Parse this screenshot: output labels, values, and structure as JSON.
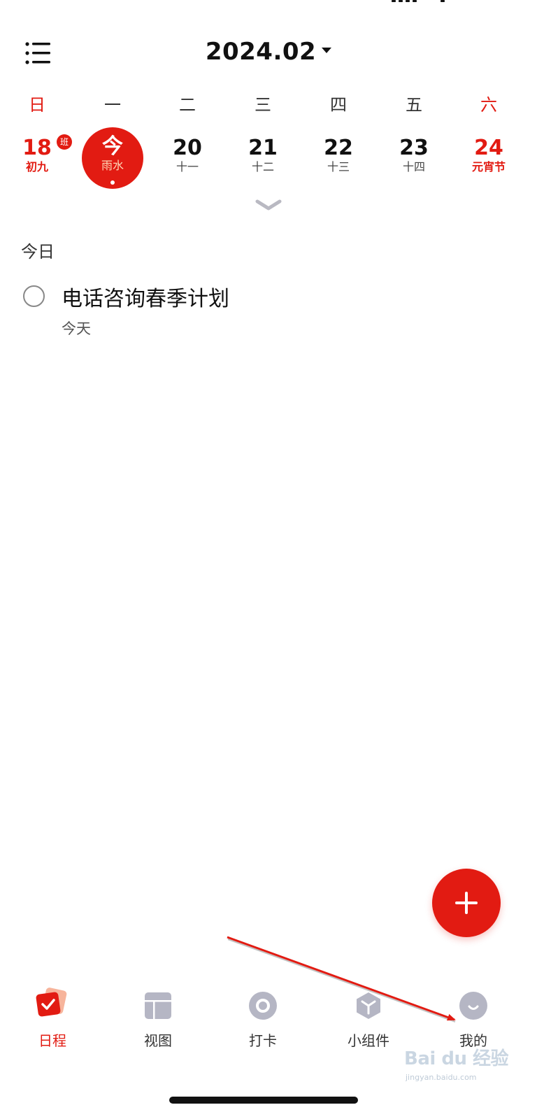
{
  "header": {
    "month_title": "2024.02"
  },
  "weekdays": [
    "日",
    "一",
    "二",
    "三",
    "四",
    "五",
    "六"
  ],
  "dates": [
    {
      "num": "18",
      "lunar": "初九",
      "badge": "班",
      "red": true
    },
    {
      "num": "今",
      "lunar": "雨水",
      "today": true
    },
    {
      "num": "20",
      "lunar": "十一"
    },
    {
      "num": "21",
      "lunar": "十二"
    },
    {
      "num": "22",
      "lunar": "十三"
    },
    {
      "num": "23",
      "lunar": "十四"
    },
    {
      "num": "24",
      "lunar": "元宵节",
      "red": true
    }
  ],
  "section": {
    "label": "今日"
  },
  "tasks": [
    {
      "title": "电话咨询春季计划",
      "date": "今天",
      "done": false
    }
  ],
  "tabbar": {
    "items": [
      {
        "label": "日程",
        "icon": "schedule-check-icon",
        "active": true
      },
      {
        "label": "视图",
        "icon": "layout-view-icon"
      },
      {
        "label": "打卡",
        "icon": "check-in-ring-icon"
      },
      {
        "label": "小组件",
        "icon": "widget-cube-icon"
      },
      {
        "label": "我的",
        "icon": "profile-smile-icon"
      }
    ]
  },
  "watermark": {
    "brand": "Bai du 经验",
    "url": "jingyan.baidu.com"
  },
  "colors": {
    "accent": "#e21b12",
    "inactive_icon": "#b5b6c4",
    "text": "#111111"
  }
}
